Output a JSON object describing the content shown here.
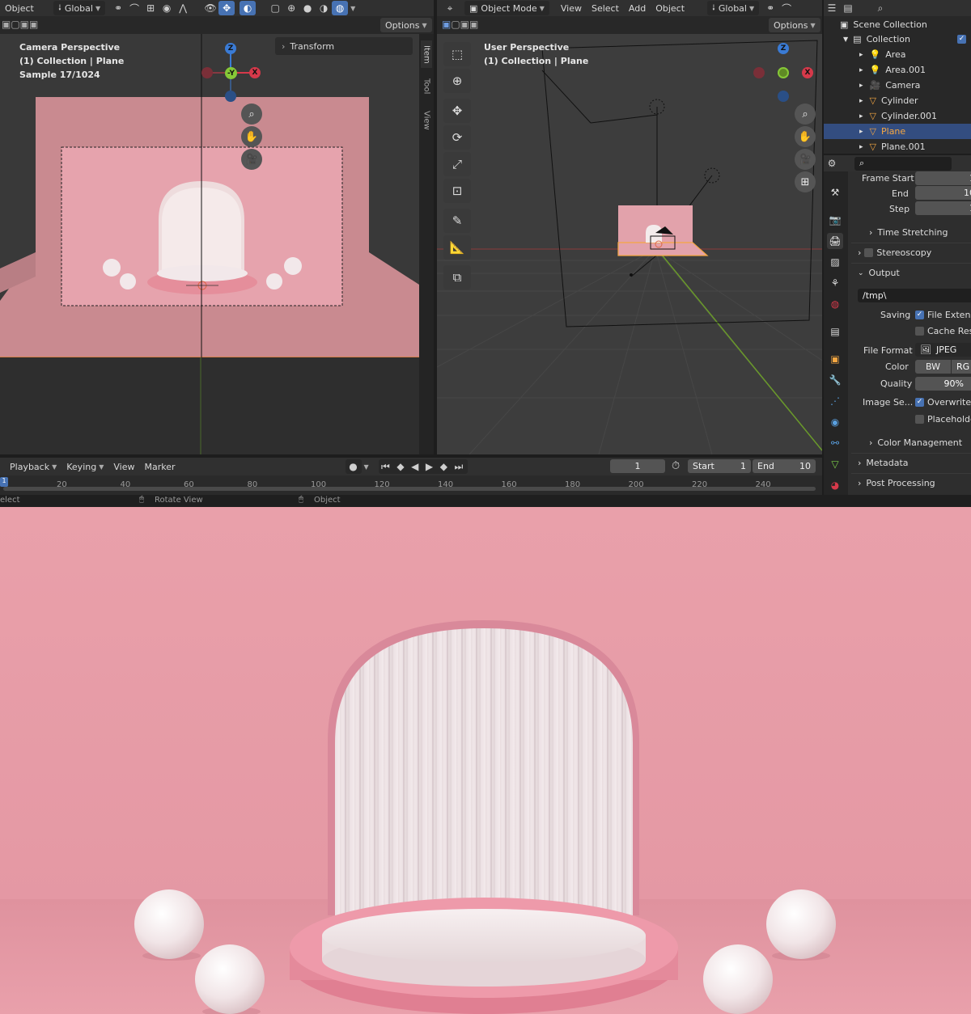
{
  "left_header": {
    "menu_object": "Object",
    "orientation": "Global",
    "options": "Options"
  },
  "left_viewport": {
    "line1": "Camera Perspective",
    "line2": "(1) Collection | Plane",
    "line3": "Sample 17/1024",
    "transform_panel": "Transform",
    "side_tabs": [
      "Item",
      "Tool",
      "View"
    ],
    "gizmo": {
      "z": "Z",
      "y": "-Y",
      "x": "X"
    }
  },
  "right_header": {
    "mode": "Object Mode",
    "menus": [
      "View",
      "Select",
      "Add",
      "Object"
    ],
    "orientation": "Global",
    "options": "Options"
  },
  "right_viewport": {
    "line1": "User Perspective",
    "line2": "(1) Collection | Plane",
    "gizmo": {
      "z": "Z",
      "x": "X"
    }
  },
  "outliner": {
    "root": "Scene Collection",
    "collection": "Collection",
    "items": [
      {
        "name": "Area",
        "icon": "light-icon",
        "selected": false
      },
      {
        "name": "Area.001",
        "icon": "light-icon",
        "selected": false
      },
      {
        "name": "Camera",
        "icon": "camera-icon",
        "selected": false
      },
      {
        "name": "Cylinder",
        "icon": "mesh-icon",
        "selected": false
      },
      {
        "name": "Cylinder.001",
        "icon": "mesh-icon",
        "selected": false
      },
      {
        "name": "Plane",
        "icon": "mesh-icon",
        "selected": true
      },
      {
        "name": "Plane.001",
        "icon": "mesh-icon",
        "selected": false
      }
    ]
  },
  "properties": {
    "frame_start_label": "Frame Start",
    "frame_start": "1",
    "end_label": "End",
    "end": "10",
    "step_label": "Step",
    "step": "1",
    "time_stretching": "Time Stretching",
    "stereoscopy": "Stereoscopy",
    "output": "Output",
    "path": "/tmp\\",
    "saving_label": "Saving",
    "file_extensions": "File Extensi",
    "cache_result": "Cache Resu",
    "file_format_label": "File Format",
    "file_format": "JPEG",
    "color_label": "Color",
    "color_bw": "BW",
    "color_rgb": "RG",
    "quality_label": "Quality",
    "quality": "90%",
    "image_sequence_label": "Image Se...",
    "overwrite": "Overwrite",
    "placeholders": "Placeholde",
    "color_management": "Color Management",
    "metadata": "Metadata",
    "post_processing": "Post Processing"
  },
  "timeline": {
    "menus": [
      "Playback",
      "Keying",
      "View",
      "Marker"
    ],
    "current_frame": "1",
    "start_label": "Start",
    "start": "1",
    "end_label": "End",
    "end": "10",
    "ticks": [
      "20",
      "40",
      "60",
      "80",
      "100",
      "120",
      "140",
      "160",
      "180",
      "200",
      "220",
      "240"
    ],
    "playhead": "1"
  },
  "status_bar": {
    "select": "elect",
    "rotate": "Rotate View",
    "object": "Object"
  },
  "colors": {
    "accent": "#4772b3",
    "scene_pink": "#e89aa6",
    "selection_orange": "#f5a742"
  }
}
